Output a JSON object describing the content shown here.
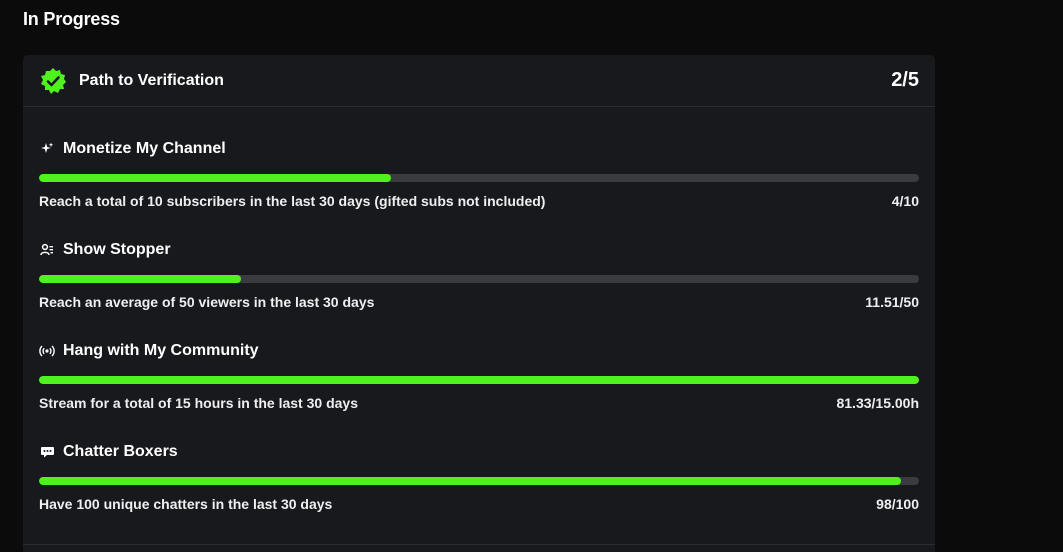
{
  "section": {
    "title": "In Progress"
  },
  "card": {
    "title": "Path to Verification",
    "count": "2/5",
    "icon": "verified-badge-icon"
  },
  "colors": {
    "accent": "#4ff21e",
    "track": "#3a3b40",
    "card_bg": "#18191d",
    "page_bg": "#0b0b0b"
  },
  "goals": [
    {
      "icon": "sparkle-icon",
      "title": "Monetize My Channel",
      "description": "Reach a total of 10 subscribers in the last 30 days (gifted subs not included)",
      "progress_text": "4/10",
      "progress": 0.4
    },
    {
      "icon": "viewers-icon",
      "title": "Show Stopper",
      "description": "Reach an average of 50 viewers in the last 30 days",
      "progress_text": "11.51/50",
      "progress": 0.23
    },
    {
      "icon": "broadcast-icon",
      "title": "Hang with My Community",
      "description": "Stream for a total of 15 hours in the last 30 days",
      "progress_text": "81.33/15.00h",
      "progress": 1.0
    },
    {
      "icon": "chat-bubble-icon",
      "title": "Chatter Boxers",
      "description": "Have 100 unique chatters in the last 30 days",
      "progress_text": "98/100",
      "progress": 0.98
    }
  ]
}
